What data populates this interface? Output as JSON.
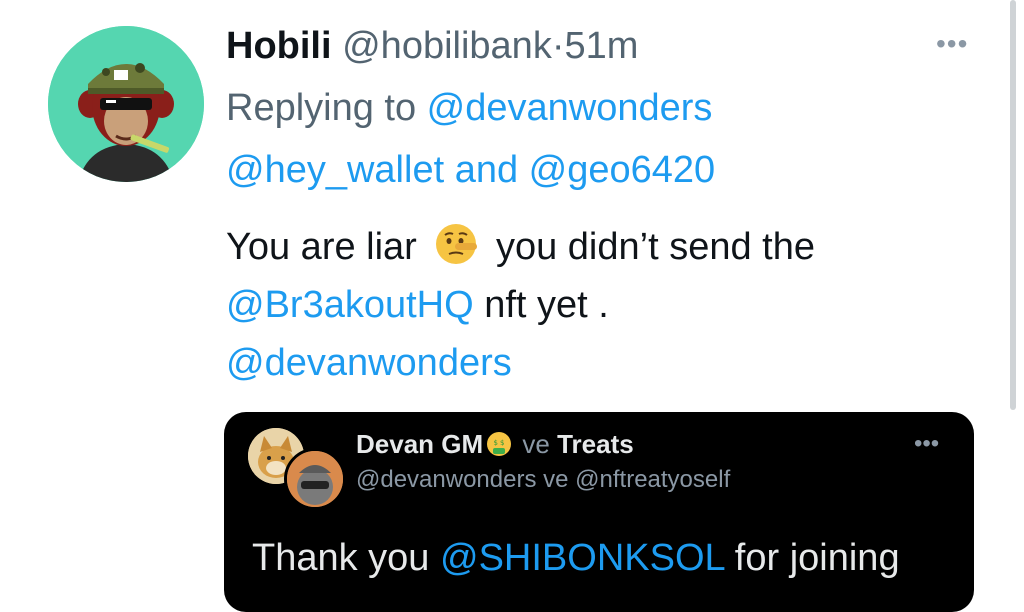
{
  "tweet": {
    "author_name": "Hobili",
    "author_handle": "@hobilibank",
    "separator": "·",
    "time": "51m",
    "more_label": "•••",
    "reply_prefix": "Replying to ",
    "reply_user1": "@devanwonders",
    "reply_user2": "@hey_wallet",
    "reply_and": " and ",
    "reply_user3": "@geo6420",
    "text_part1": "You are liar ",
    "emoji": "lying-face-emoji",
    "text_part2": " you didn’t send the",
    "mention1": "@Br3akoutHQ",
    "text_part3": " nft yet .",
    "mention2": "@devanwonders"
  },
  "quote": {
    "name1": "Devan GM",
    "emoji": "money-mouth-face-emoji",
    "connector": " ve ",
    "name2": "Treats",
    "handle1": "@devanwonders",
    "handle2": "@nftreatyoself",
    "more_label": "•••",
    "text_part1": "Thank you ",
    "mention": "@SHIBONKSOL",
    "text_part2": " for joining"
  },
  "colors": {
    "link": "#1d9bf0",
    "secondary_text": "#536471",
    "avatar_bg": "#55d6b0",
    "quote_bg": "#000000"
  }
}
